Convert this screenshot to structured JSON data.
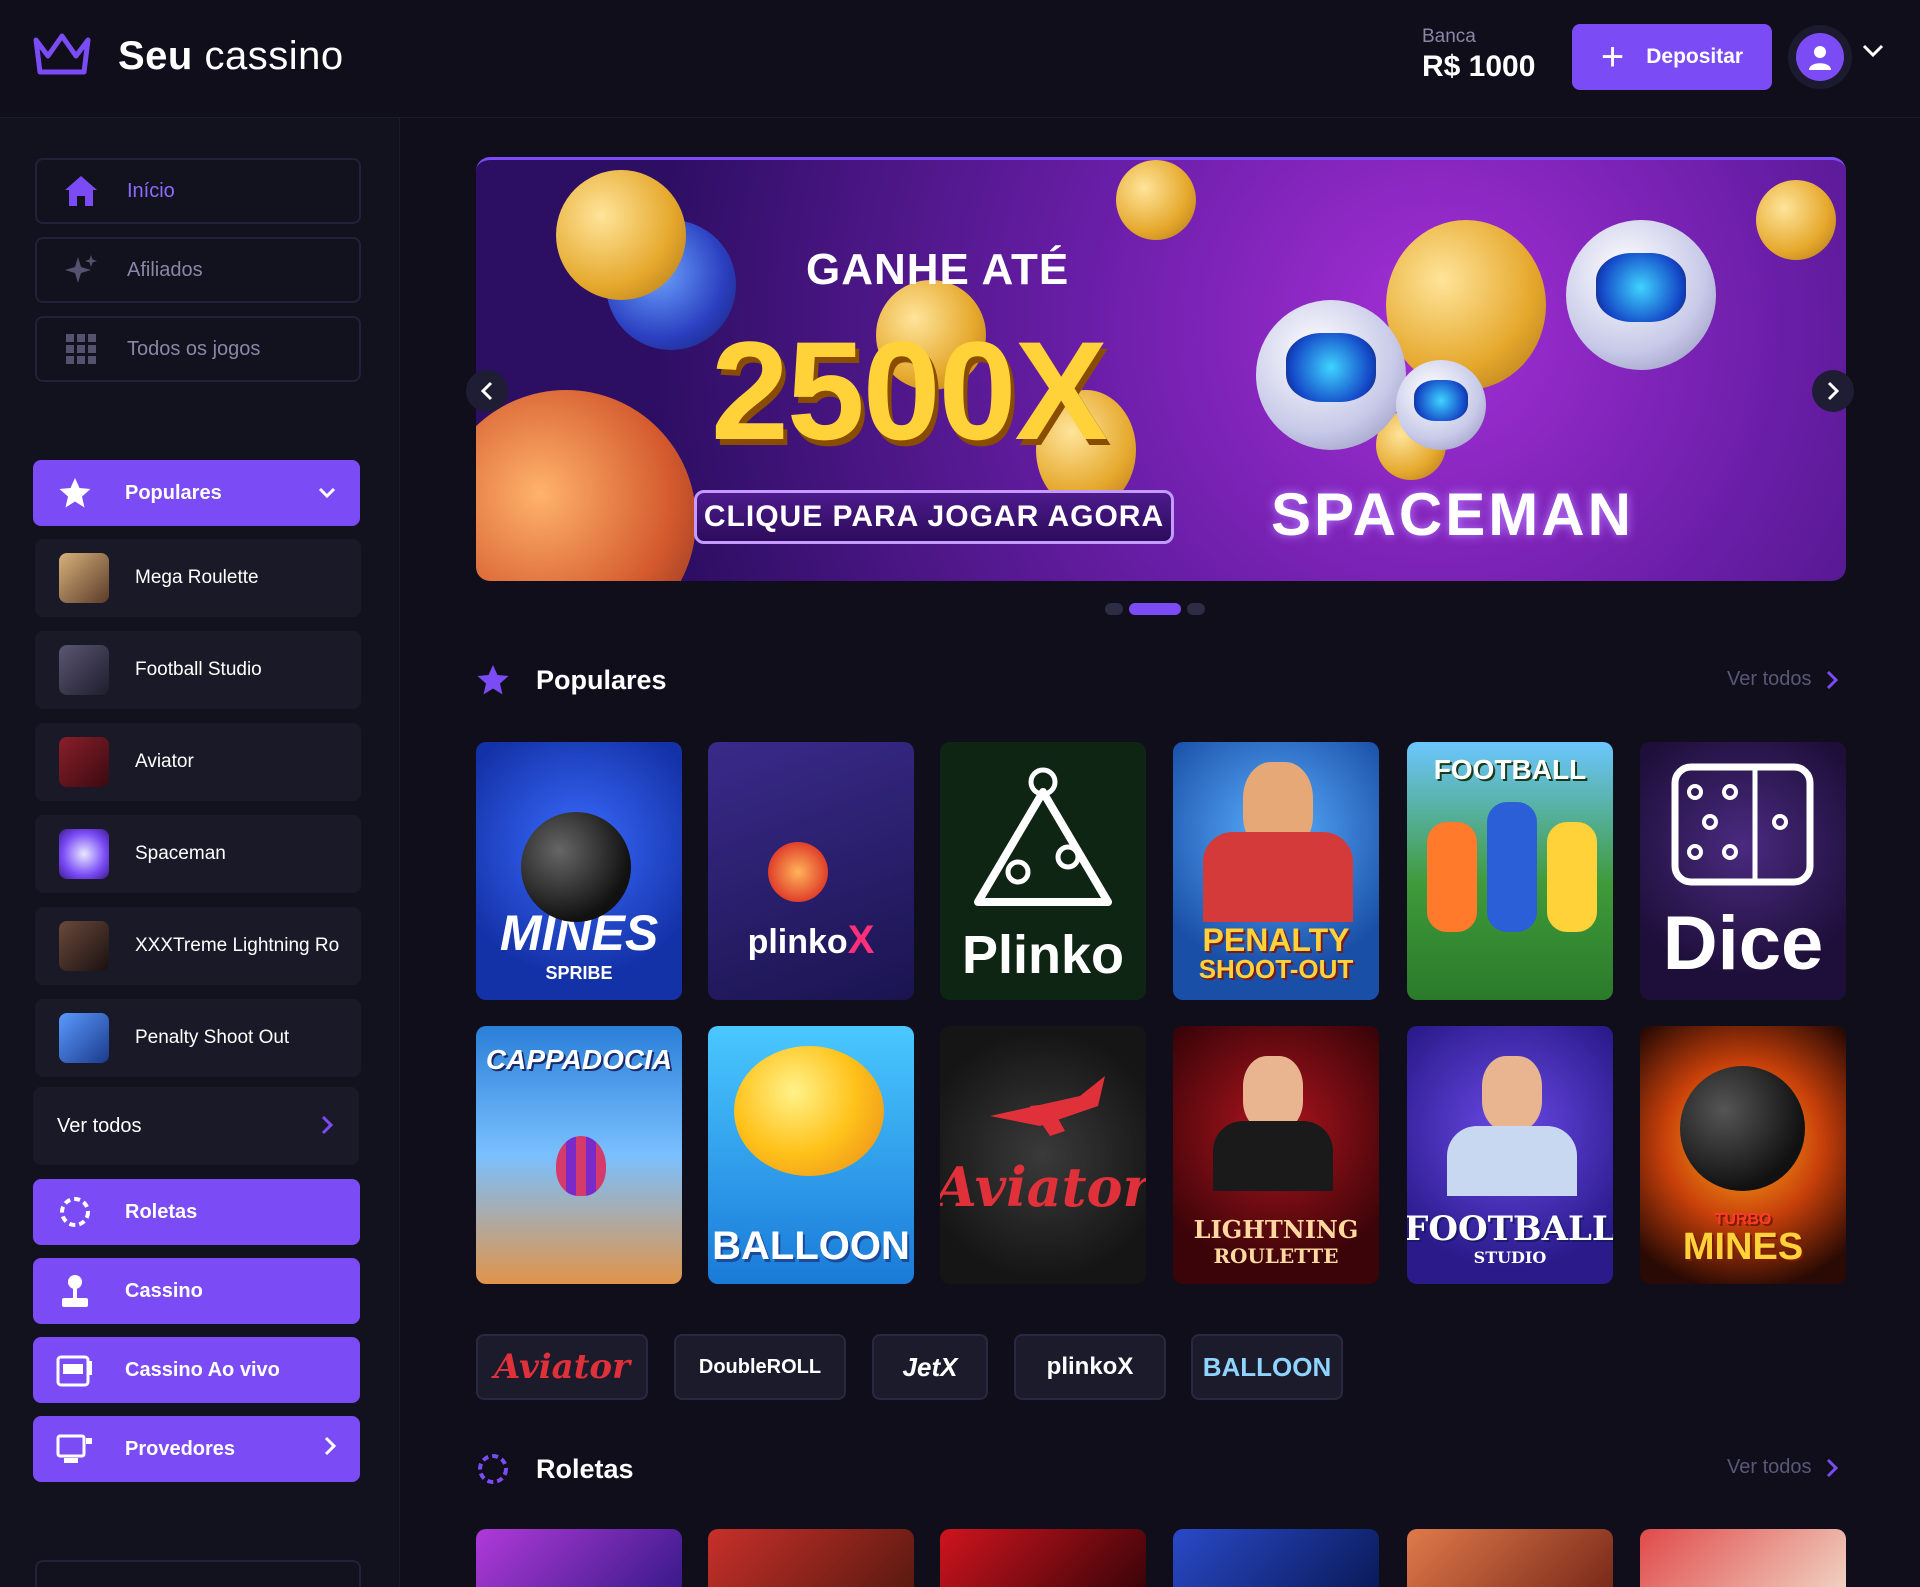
{
  "header": {
    "logo_bold": "Seu",
    "logo_light": "cassino",
    "banca_label": "Banca",
    "banca_value": "R$ 1000",
    "deposit_label": "Depositar"
  },
  "sidebar": {
    "nav": [
      {
        "label": "Início",
        "icon": "home-icon"
      },
      {
        "label": "Afiliados",
        "icon": "sparkles-icon"
      },
      {
        "label": "Todos os jogos",
        "icon": "grid-icon"
      }
    ],
    "populares_label": "Populares",
    "games": [
      {
        "label": "Mega Roulette",
        "color": "#b89a6a"
      },
      {
        "label": "Football Studio",
        "color": "#3a3550"
      },
      {
        "label": "Aviator",
        "color": "#6a1a22"
      },
      {
        "label": "Spaceman",
        "color": "#6b3cc8"
      },
      {
        "label": "XXXTreme Lightning Ro",
        "color": "#3a2a22"
      },
      {
        "label": "Penalty Shoot Out",
        "color": "#3b6fc8"
      }
    ],
    "ver_todos": "Ver todos",
    "sections": [
      {
        "label": "Roletas",
        "icon": "roulette-icon"
      },
      {
        "label": "Cassino",
        "icon": "joystick-icon"
      },
      {
        "label": "Cassino Ao vivo",
        "icon": "slot-machine-icon"
      },
      {
        "label": "Provedores",
        "icon": "provider-icon"
      }
    ]
  },
  "banner": {
    "line1": "GANHE ATÉ",
    "line2": "2500X",
    "cta": "CLIQUE PARA JOGAR AGORA",
    "brand": "SPACEMAN"
  },
  "populares": {
    "title": "Populares",
    "ver_todos": "Ver todos",
    "games": [
      {
        "label": "MINES",
        "sub": "SPRIBE",
        "bg": "#1e3fc0"
      },
      {
        "label": "plinko",
        "sub": "",
        "bg": "#2a1f6a"
      },
      {
        "label": "Plinko",
        "sub": "",
        "bg": "#0c2a12"
      },
      {
        "label": "PENALTY",
        "sub": "SHOOT-OUT",
        "bg": "#1f4fa8"
      },
      {
        "label": "FOOTBALL",
        "sub": "",
        "bg": "#3f9a3a"
      },
      {
        "label": "Dice",
        "sub": "",
        "bg": "#2a1448"
      },
      {
        "label": "CAPPADOCIA",
        "sub": "",
        "bg": "#2a7fd8"
      },
      {
        "label": "BALLOON",
        "sub": "",
        "bg": "#1a9ae0"
      },
      {
        "label": "Aviator",
        "sub": "",
        "bg": "#1f1f1f"
      },
      {
        "label": "LIGHTNING",
        "sub": "ROULETTE",
        "bg": "#5a0a10"
      },
      {
        "label": "FOOTBALL",
        "sub": "STUDIO",
        "bg": "#3a28b8"
      },
      {
        "label": "MINES",
        "sub": "TURBO",
        "bg": "#7a2a08"
      }
    ]
  },
  "providers": [
    {
      "label": "Aviator",
      "color": "#e0303a"
    },
    {
      "label": "DoubleROLL",
      "color": "#ffffff"
    },
    {
      "label": "JetX",
      "color": "#ffffff"
    },
    {
      "label": "plinkoX",
      "color": "#ffffff"
    },
    {
      "label": "BALLOON",
      "color": "#8fd4ff"
    }
  ],
  "roletas": {
    "title": "Roletas",
    "ver_todos": "Ver todos"
  },
  "colors": {
    "accent": "#7b4cf6",
    "background": "#0f0e1a",
    "sidebar_bg": "#12111e"
  }
}
